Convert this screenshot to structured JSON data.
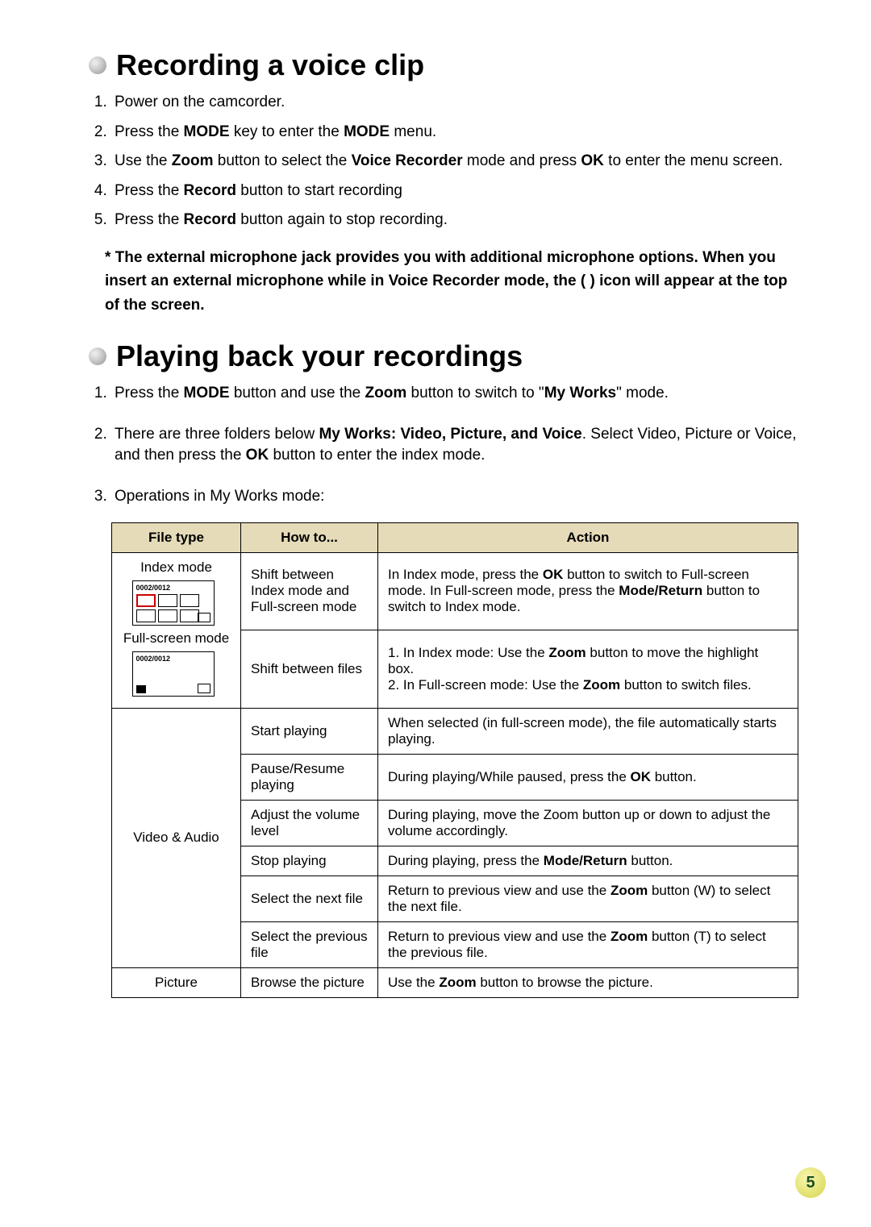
{
  "section1": {
    "heading": "Recording a voice clip",
    "steps": [
      {
        "text": "Power on the camcorder."
      },
      {
        "pre": "Press the ",
        "b1": "MODE",
        "mid": " key to enter the ",
        "b2": "MODE",
        "post": " menu."
      },
      {
        "pre": "Use the ",
        "b1": "Zoom",
        "mid": " button to select the ",
        "b2": "Voice Recorder",
        "mid2": " mode and press ",
        "b3": "OK",
        "post": " to enter the menu screen."
      },
      {
        "pre": " Press the ",
        "b1": "Record",
        "post": " button to start recording"
      },
      {
        "pre": "Press the ",
        "b1": "Record",
        "post": " button again to stop recording."
      }
    ],
    "note": "*  The external microphone jack provides you with additional microphone options. When you insert an external microphone while in Voice Recorder mode, the (        ) icon will appear at the top of the screen."
  },
  "section2": {
    "heading": "Playing back your recordings",
    "steps": [
      {
        "pre": " Press the ",
        "b1": "MODE",
        "mid": " button and use the ",
        "b2": "Zoom",
        "mid2": " button to switch to \"",
        "b3": "My Works",
        "post": "\" mode."
      },
      {
        "pre": "There are three folders below ",
        "b1": "My Works: Video, Picture, and Voice",
        "mid": ". Select Video, Picture or Voice, and then press the ",
        "b2": "OK",
        "post": " button to enter the index mode."
      },
      {
        "text": " Operations in My Works mode:"
      }
    ]
  },
  "table": {
    "headers": {
      "c1": "File type",
      "c2": "How to...",
      "c3": "Action"
    },
    "row1": {
      "filetype_label1": "Index mode",
      "filetype_counter": "0002/0012",
      "filetype_label2": "Full-screen mode",
      "howto": "Shift between Index mode and Full-screen mode",
      "action_pre": "In Index mode, press the ",
      "action_b1": "OK",
      "action_mid": " button to switch to Full-screen mode. In Full-screen mode, press the ",
      "action_b2": "Mode/Return",
      "action_post": " button to switch to Index mode."
    },
    "row2": {
      "howto": "Shift between files",
      "action_pre1": "1. In Index mode: Use the ",
      "action_b1": "Zoom",
      "action_mid1": " button to move the highlight box.",
      "action_pre2": "2. In Full-screen mode: Use the ",
      "action_b2": "Zoom",
      "action_post2": " button to switch files."
    },
    "row3": {
      "howto": "Start playing",
      "action": "When selected (in full-screen mode), the file automatically starts playing."
    },
    "row4": {
      "howto": "Pause/Resume playing",
      "action_pre": "During playing/While paused, press the ",
      "action_b": "OK",
      "action_post": " button."
    },
    "row5": {
      "filetype": "Video & Audio",
      "howto": "Adjust the volume level",
      "action": "During playing, move the Zoom button up or down to adjust the volume accordingly."
    },
    "row6": {
      "howto": "Stop playing",
      "action_pre": "During playing, press the ",
      "action_b": "Mode/Return",
      "action_post": " button."
    },
    "row7": {
      "howto": "Select the next file",
      "action_pre": "Return to previous view and use the ",
      "action_b": "Zoom",
      "action_post": " button (W) to select the next file."
    },
    "row8": {
      "howto": "Select the previous file",
      "action_pre": "Return to previous view and use the ",
      "action_b": "Zoom",
      "action_post": " button (T) to select the previous file."
    },
    "row9": {
      "filetype": "Picture",
      "howto": "Browse the picture",
      "action_pre": "Use the ",
      "action_b": "Zoom",
      "action_post": " button to browse the picture."
    }
  },
  "page_number": "5"
}
